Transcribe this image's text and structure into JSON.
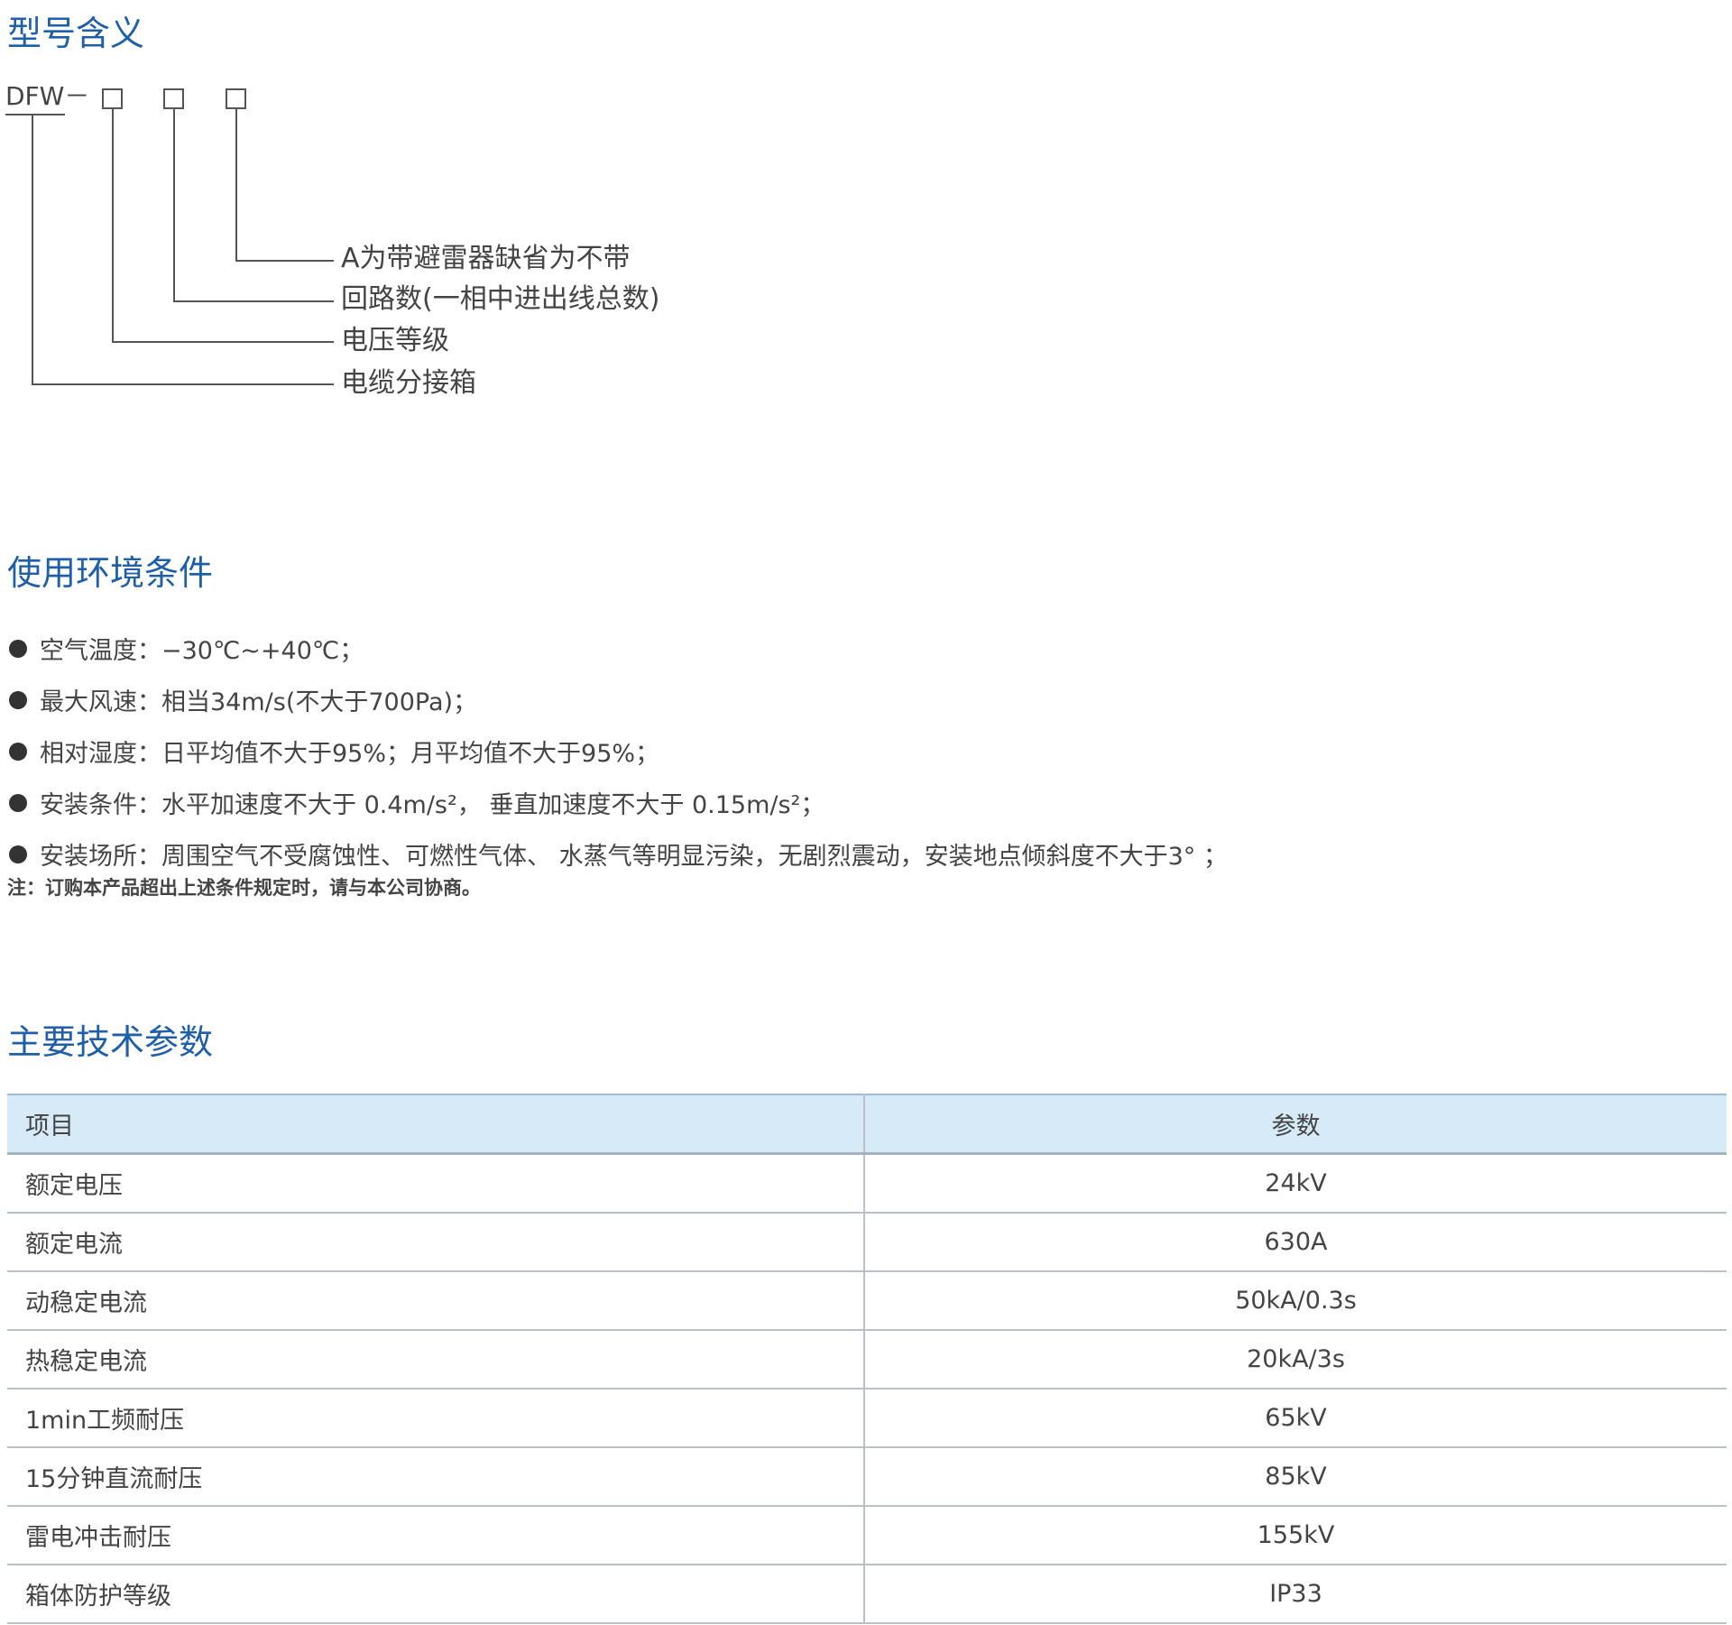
{
  "sections": {
    "model_meaning": "型号含义",
    "environment": "使用环境条件",
    "tech_params": "主要技术参数"
  },
  "model": {
    "prefix": "DFW－",
    "labels": [
      "A为带避雷器缺省为不带",
      "回路数(一相中进出线总数)",
      "电压等级",
      "电缆分接箱"
    ]
  },
  "conditions": [
    "空气温度：−30℃~+40℃；",
    "最大风速：相当34m/s(不大于700Pa)；",
    "相对湿度：日平均值不大于95%；月平均值不大于95%；",
    "安装条件：水平加速度不大于 0.4m/s²， 垂直加速度不大于 0.15m/s²；",
    "安装场所：周围空气不受腐蚀性、可燃性气体、 水蒸气等明显污染，无剧烈震动，安装地点倾斜度不大于3°  ；"
  ],
  "note": "注：订购本产品超出上述条件规定时，请与本公司协商。",
  "table": {
    "headers": [
      "项目",
      "参数"
    ],
    "rows": [
      [
        "额定电压",
        "24kV"
      ],
      [
        "额定电流",
        "630A"
      ],
      [
        "动稳定电流",
        "50kA/0.3s"
      ],
      [
        "热稳定电流",
        "20kA/3s"
      ],
      [
        "1min工频耐压",
        "65kV"
      ],
      [
        "15分钟直流耐压",
        "85kV"
      ],
      [
        "雷电冲击耐压",
        "155kV"
      ],
      [
        "箱体防护等级",
        "IP33"
      ]
    ]
  },
  "colors": {
    "title": "#1f5fa8",
    "table_header_bg": "#d6ebf7"
  }
}
